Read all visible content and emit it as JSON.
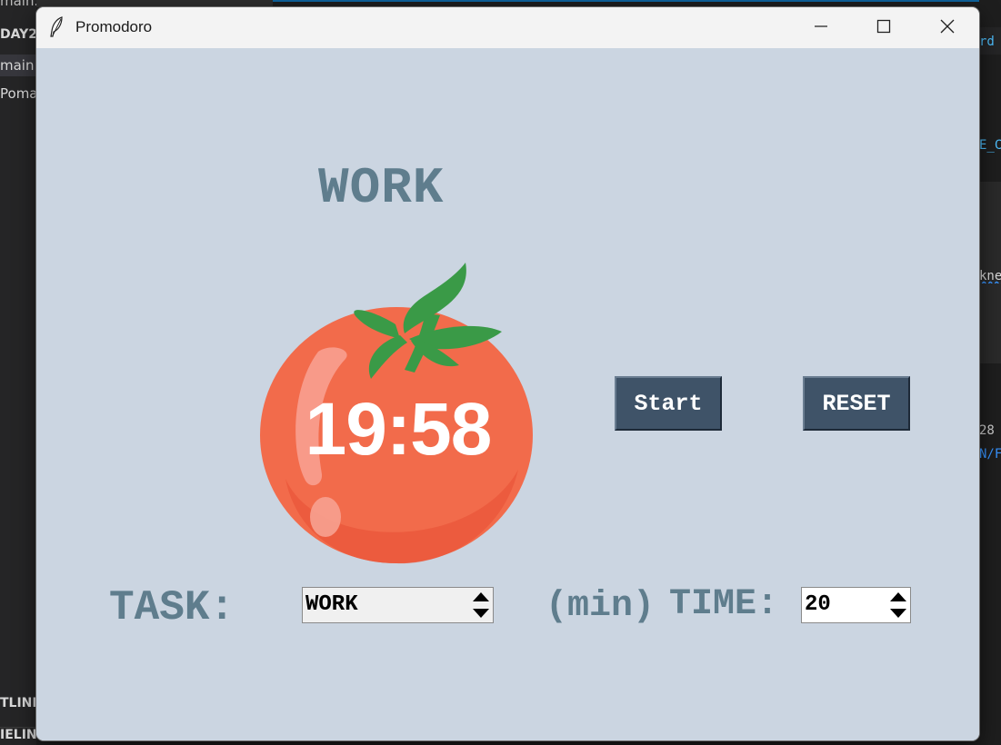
{
  "background_editor": {
    "left_rows": [
      "main.py",
      "DAY2",
      "main.",
      "Poma",
      "TLINE",
      "IELINE"
    ],
    "right_fragments": [
      "rd",
      "E_C",
      "kne",
      "28",
      "N/F"
    ]
  },
  "window": {
    "title": "Promodoro",
    "app_icon": "feather-icon",
    "controls": {
      "minimize": "minimize-icon",
      "maximize": "maximize-icon",
      "close": "close-icon"
    }
  },
  "app": {
    "mode_label": "WORK",
    "timer_text": "19:58",
    "start_label": "Start",
    "reset_label": "RESET",
    "task_label": "TASK:",
    "task_value": "WORK",
    "min_label": "(min)",
    "time_label": "TIME:",
    "time_value": "20"
  },
  "colors": {
    "background": "#cbd5e1",
    "label_text": "#5f7d8d",
    "button_bg": "#3f5368",
    "tomato": "#f26b4b",
    "leaves": "#3a9a47"
  }
}
